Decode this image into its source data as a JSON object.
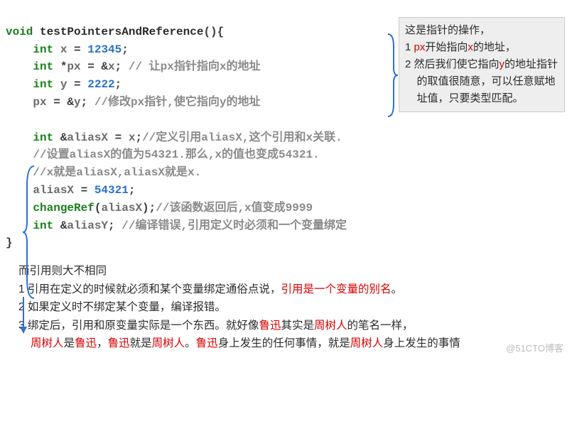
{
  "code": {
    "fn_kw": "void",
    "fn_name": "testPointersAndReference",
    "fn_parens": "(){",
    "l1_kw": "int",
    "l1_var": "x",
    "l1_eq": " = ",
    "l1_num": "12345",
    "l1_end": ";",
    "l2_kw": "int",
    "l2_star": " *",
    "l2_var": "px",
    "l2_eq": " = &",
    "l2_rhs": "x",
    "l2_end": ";",
    "l2_com": " // 让px指针指向x的地址",
    "l3_kw": "int",
    "l3_var": "y",
    "l3_eq": " = ",
    "l3_num": "2222",
    "l3_end": ";",
    "l4_var": "px",
    "l4_eq": " = &",
    "l4_rhs": "y",
    "l4_end": ";",
    "l4_com": " //修改px指针,使它指向y的地址",
    "l5_kw": "int",
    "l5_amp": " &",
    "l5_var": "aliasX",
    "l5_eq": " = ",
    "l5_rhs": "x",
    "l5_end": ";",
    "l5_com": "//定义引用aliasX,这个引用和x关联.",
    "l6_com": "//设置aliasX的值为54321.那么,x的值也变成54321.",
    "l7_com": "//x就是aliasX,aliasX就是x.",
    "l8_var": "aliasX",
    "l8_eq": " = ",
    "l8_num": "54321",
    "l8_end": ";",
    "l9_fn": "changeRef",
    "l9_open": "(",
    "l9_arg": "aliasX",
    "l9_close": ");",
    "l9_com": "//该函数返回后,x值变成9999",
    "l10_kw": "int",
    "l10_amp": " &",
    "l10_var": "aliasY",
    "l10_end": ";",
    "l10_com": " //编译错误,引用定义时必须和一个变量绑定",
    "close": "}"
  },
  "note": {
    "t1": "这是指针的操作，",
    "t2a": "1 ",
    "t2b": "px",
    "t2c": "开始指向",
    "t2d": "x",
    "t2e": "的地址，",
    "t3a": "2 然后我们使它指向",
    "t3b": "y",
    "t3c": "的地址指针的取值很随意，可以任意赋地址值，只要类型匹配。"
  },
  "explain": {
    "h": "而引用则大不相同",
    "p1a": "1 引用在定义的时候就必须和某个变量绑定通俗点说，",
    "p1b": "引用是一个变量的别名",
    "p1c": "。",
    "p2": "2 如果定义时不绑定某个变量，编译报错。",
    "p3a": "3 绑定后，引用和原变量实际是一个东西。就好像",
    "p3b": "鲁迅",
    "p3c": "其实是",
    "p3d": "周树人",
    "p3e": "的笔名一样，",
    "p4a": "周树人",
    "p4b": "是",
    "p4c": "鲁迅",
    "p4d": "，",
    "p4e": "鲁迅",
    "p4f": "就是",
    "p4g": "周树人",
    "p4h": "。",
    "p4i": "鲁迅",
    "p4j": "身上发生的任何事情，就是",
    "p4k": "周树人",
    "p4l": "身上发生的事情"
  },
  "watermark": "@51CTO博客"
}
